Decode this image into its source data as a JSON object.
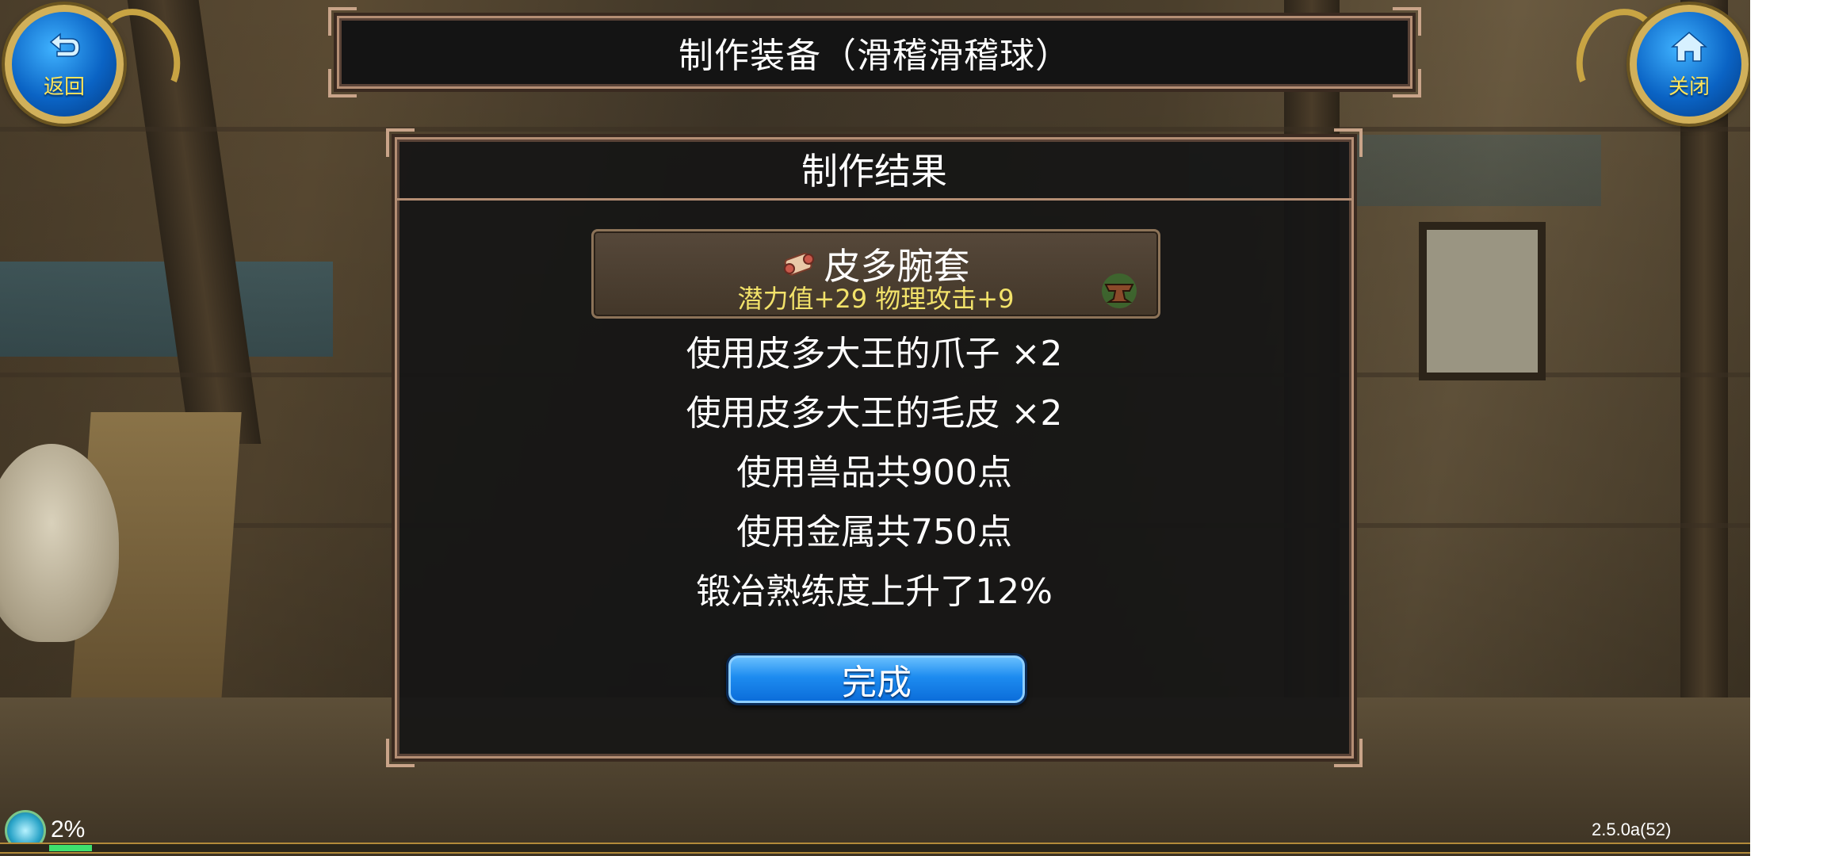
{
  "top_bar": {
    "title": "制作装备（滑稽滑稽球）",
    "back_button_label": "返回",
    "close_button_label": "关闭",
    "back_icon": "return-arrow-icon",
    "close_icon": "home-icon"
  },
  "result_panel": {
    "header": "制作结果",
    "item": {
      "name": "皮多腕套",
      "stats": "潜力值+29 物理攻击+9",
      "type_icon": "scroll-icon",
      "craft_icon": "anvil-icon"
    },
    "lines": [
      "使用皮多大王的爪子 ×2",
      "使用皮多大王的毛皮 ×2",
      "使用兽品共900点",
      "使用金属共750点",
      "锻冶熟练度上升了12%"
    ],
    "done_button_label": "完成",
    "done_button_color": "#1d8cf0"
  },
  "hud": {
    "exp_percent_text": "2%",
    "exp_fraction": 0.02,
    "version": "2.5.0a(52)"
  }
}
